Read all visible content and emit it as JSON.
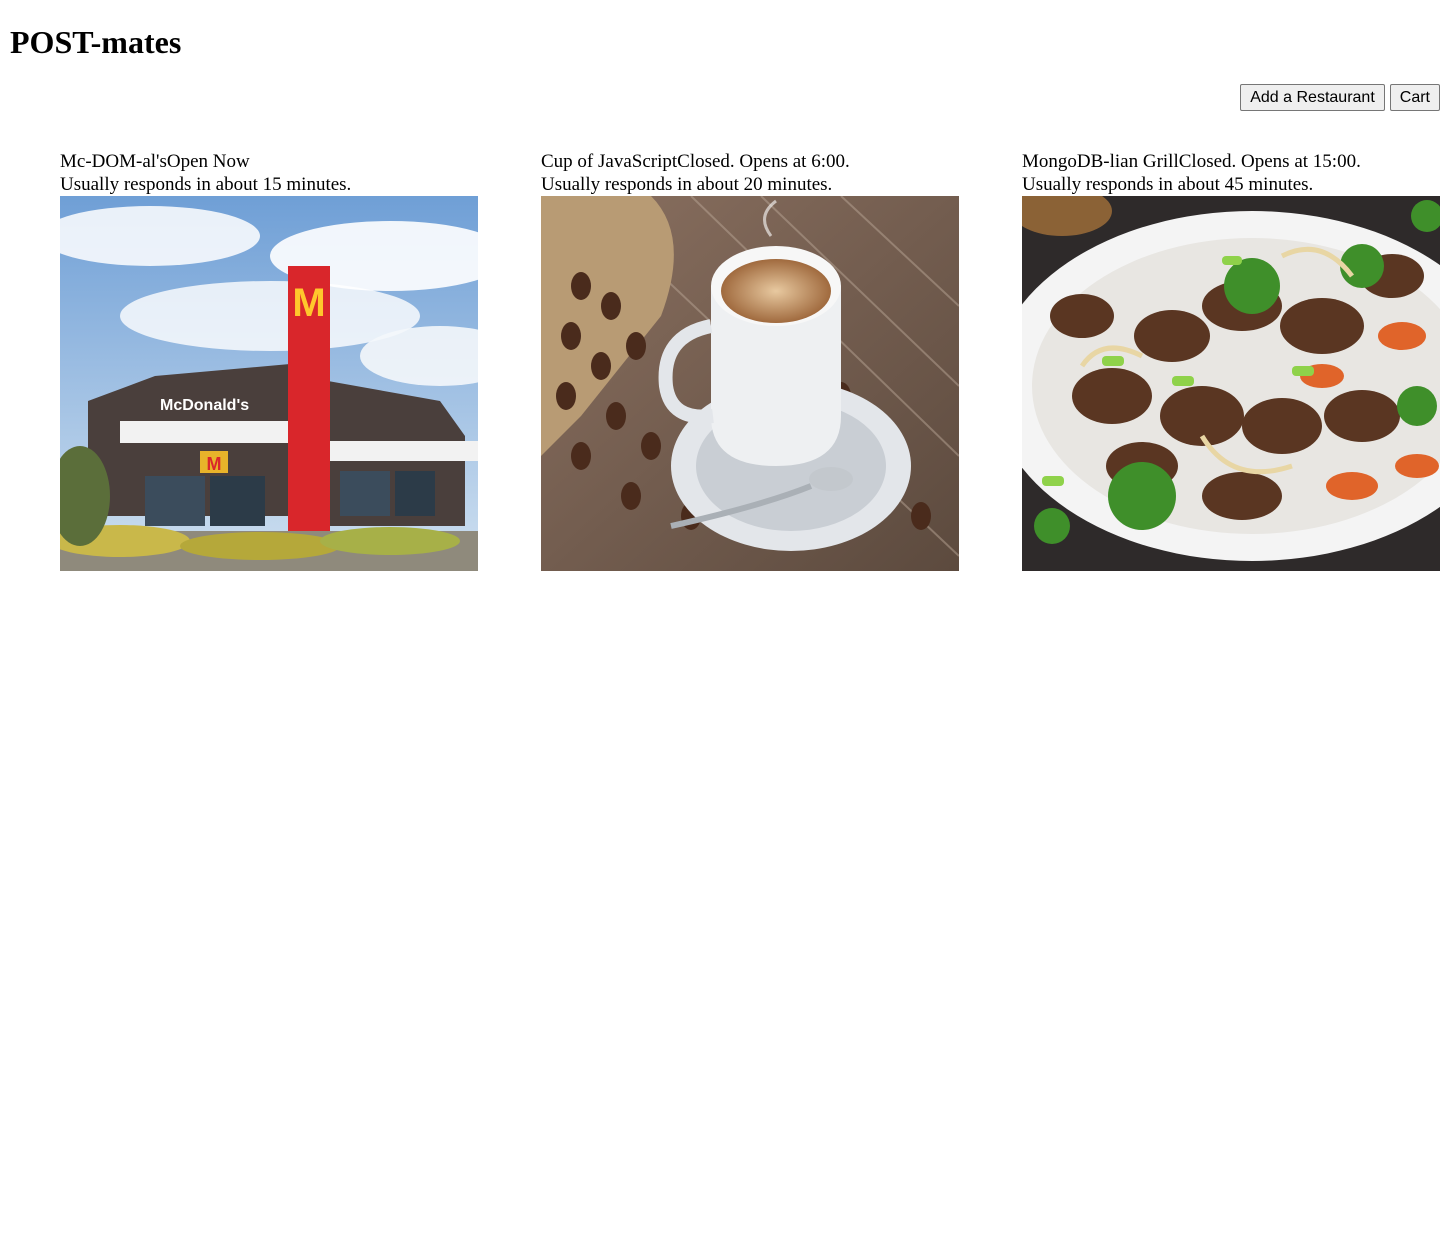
{
  "app": {
    "title": "POST-mates"
  },
  "toolbar": {
    "add_label": "Add a Restaurant",
    "cart_label": "Cart"
  },
  "restaurants": [
    {
      "name": "Mc-DOM-al's",
      "status": "Open Now",
      "response": "Usually responds in about 15 minutes.",
      "image": "restaurant-storefront",
      "sign_text": "McDonald's"
    },
    {
      "name": "Cup of JavaScript",
      "status": "Closed. Opens at 6:00.",
      "response": "Usually responds in about 20 minutes.",
      "image": "coffee-cup-and-beans"
    },
    {
      "name": "MongoDB-lian Grill",
      "status": "Closed. Opens at 15:00.",
      "response": "Usually responds in about 45 minutes.",
      "image": "beef-stir-fry-plate"
    }
  ]
}
